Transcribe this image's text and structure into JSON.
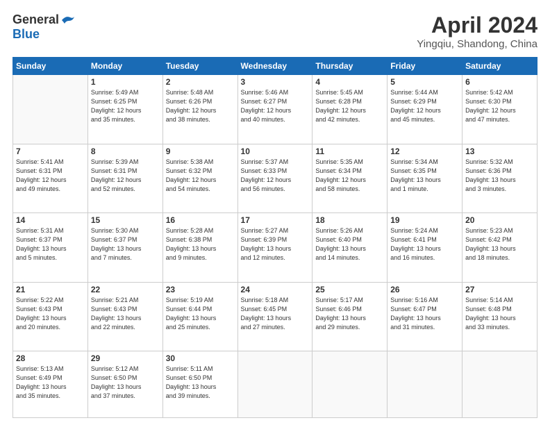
{
  "header": {
    "logo_general": "General",
    "logo_blue": "Blue",
    "title": "April 2024",
    "subtitle": "Yingqiu, Shandong, China"
  },
  "weekdays": [
    "Sunday",
    "Monday",
    "Tuesday",
    "Wednesday",
    "Thursday",
    "Friday",
    "Saturday"
  ],
  "weeks": [
    [
      {
        "day": "",
        "info": ""
      },
      {
        "day": "1",
        "info": "Sunrise: 5:49 AM\nSunset: 6:25 PM\nDaylight: 12 hours\nand 35 minutes."
      },
      {
        "day": "2",
        "info": "Sunrise: 5:48 AM\nSunset: 6:26 PM\nDaylight: 12 hours\nand 38 minutes."
      },
      {
        "day": "3",
        "info": "Sunrise: 5:46 AM\nSunset: 6:27 PM\nDaylight: 12 hours\nand 40 minutes."
      },
      {
        "day": "4",
        "info": "Sunrise: 5:45 AM\nSunset: 6:28 PM\nDaylight: 12 hours\nand 42 minutes."
      },
      {
        "day": "5",
        "info": "Sunrise: 5:44 AM\nSunset: 6:29 PM\nDaylight: 12 hours\nand 45 minutes."
      },
      {
        "day": "6",
        "info": "Sunrise: 5:42 AM\nSunset: 6:30 PM\nDaylight: 12 hours\nand 47 minutes."
      }
    ],
    [
      {
        "day": "7",
        "info": "Sunrise: 5:41 AM\nSunset: 6:31 PM\nDaylight: 12 hours\nand 49 minutes."
      },
      {
        "day": "8",
        "info": "Sunrise: 5:39 AM\nSunset: 6:31 PM\nDaylight: 12 hours\nand 52 minutes."
      },
      {
        "day": "9",
        "info": "Sunrise: 5:38 AM\nSunset: 6:32 PM\nDaylight: 12 hours\nand 54 minutes."
      },
      {
        "day": "10",
        "info": "Sunrise: 5:37 AM\nSunset: 6:33 PM\nDaylight: 12 hours\nand 56 minutes."
      },
      {
        "day": "11",
        "info": "Sunrise: 5:35 AM\nSunset: 6:34 PM\nDaylight: 12 hours\nand 58 minutes."
      },
      {
        "day": "12",
        "info": "Sunrise: 5:34 AM\nSunset: 6:35 PM\nDaylight: 13 hours\nand 1 minute."
      },
      {
        "day": "13",
        "info": "Sunrise: 5:32 AM\nSunset: 6:36 PM\nDaylight: 13 hours\nand 3 minutes."
      }
    ],
    [
      {
        "day": "14",
        "info": "Sunrise: 5:31 AM\nSunset: 6:37 PM\nDaylight: 13 hours\nand 5 minutes."
      },
      {
        "day": "15",
        "info": "Sunrise: 5:30 AM\nSunset: 6:37 PM\nDaylight: 13 hours\nand 7 minutes."
      },
      {
        "day": "16",
        "info": "Sunrise: 5:28 AM\nSunset: 6:38 PM\nDaylight: 13 hours\nand 9 minutes."
      },
      {
        "day": "17",
        "info": "Sunrise: 5:27 AM\nSunset: 6:39 PM\nDaylight: 13 hours\nand 12 minutes."
      },
      {
        "day": "18",
        "info": "Sunrise: 5:26 AM\nSunset: 6:40 PM\nDaylight: 13 hours\nand 14 minutes."
      },
      {
        "day": "19",
        "info": "Sunrise: 5:24 AM\nSunset: 6:41 PM\nDaylight: 13 hours\nand 16 minutes."
      },
      {
        "day": "20",
        "info": "Sunrise: 5:23 AM\nSunset: 6:42 PM\nDaylight: 13 hours\nand 18 minutes."
      }
    ],
    [
      {
        "day": "21",
        "info": "Sunrise: 5:22 AM\nSunset: 6:43 PM\nDaylight: 13 hours\nand 20 minutes."
      },
      {
        "day": "22",
        "info": "Sunrise: 5:21 AM\nSunset: 6:43 PM\nDaylight: 13 hours\nand 22 minutes."
      },
      {
        "day": "23",
        "info": "Sunrise: 5:19 AM\nSunset: 6:44 PM\nDaylight: 13 hours\nand 25 minutes."
      },
      {
        "day": "24",
        "info": "Sunrise: 5:18 AM\nSunset: 6:45 PM\nDaylight: 13 hours\nand 27 minutes."
      },
      {
        "day": "25",
        "info": "Sunrise: 5:17 AM\nSunset: 6:46 PM\nDaylight: 13 hours\nand 29 minutes."
      },
      {
        "day": "26",
        "info": "Sunrise: 5:16 AM\nSunset: 6:47 PM\nDaylight: 13 hours\nand 31 minutes."
      },
      {
        "day": "27",
        "info": "Sunrise: 5:14 AM\nSunset: 6:48 PM\nDaylight: 13 hours\nand 33 minutes."
      }
    ],
    [
      {
        "day": "28",
        "info": "Sunrise: 5:13 AM\nSunset: 6:49 PM\nDaylight: 13 hours\nand 35 minutes."
      },
      {
        "day": "29",
        "info": "Sunrise: 5:12 AM\nSunset: 6:50 PM\nDaylight: 13 hours\nand 37 minutes."
      },
      {
        "day": "30",
        "info": "Sunrise: 5:11 AM\nSunset: 6:50 PM\nDaylight: 13 hours\nand 39 minutes."
      },
      {
        "day": "",
        "info": ""
      },
      {
        "day": "",
        "info": ""
      },
      {
        "day": "",
        "info": ""
      },
      {
        "day": "",
        "info": ""
      }
    ]
  ]
}
